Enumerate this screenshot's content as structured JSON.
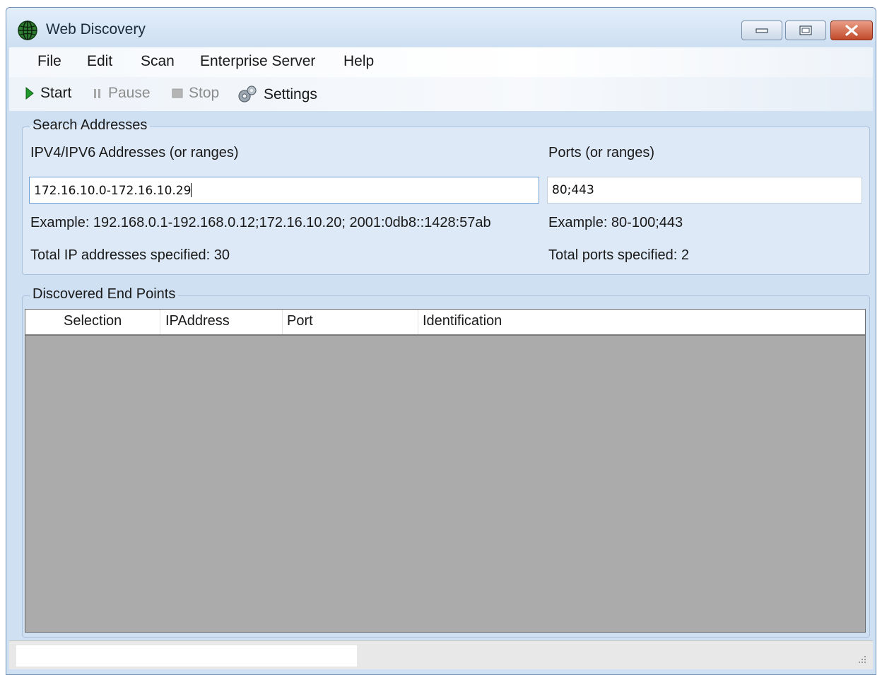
{
  "window": {
    "title": "Web Discovery",
    "app_icon": "globe-icon",
    "controls": [
      "minimize-icon",
      "maximize-icon",
      "close-icon"
    ]
  },
  "menu": [
    "File",
    "Edit",
    "Scan",
    "Enterprise Server",
    "Help"
  ],
  "toolbar": {
    "start": "Start",
    "pause": "Pause",
    "stop": "Stop",
    "settings": "Settings"
  },
  "search": {
    "group_title": "Search Addresses",
    "ip_label": "IPV4/IPV6 Addresses (or ranges)",
    "ip_value": "172.16.10.0-172.16.10.29",
    "ip_example": "Example: 192.168.0.1-192.168.0.12;172.16.10.20; 2001:0db8::1428:57ab",
    "ip_total": "Total IP addresses specified:  30",
    "ports_label": "Ports (or ranges)",
    "ports_value": "80;443",
    "ports_example": "Example: 80-100;443",
    "ports_total": "Total ports specified:  2"
  },
  "results": {
    "group_title": "Discovered End Points",
    "columns": [
      "Selection",
      "IPAddress",
      "Port",
      "Identification"
    ],
    "rows": []
  },
  "status": {
    "text": ""
  },
  "colors": {
    "window_bg": "#cfe0f3",
    "grid_bg": "#ababab",
    "start_icon": "#1f9a2a"
  }
}
